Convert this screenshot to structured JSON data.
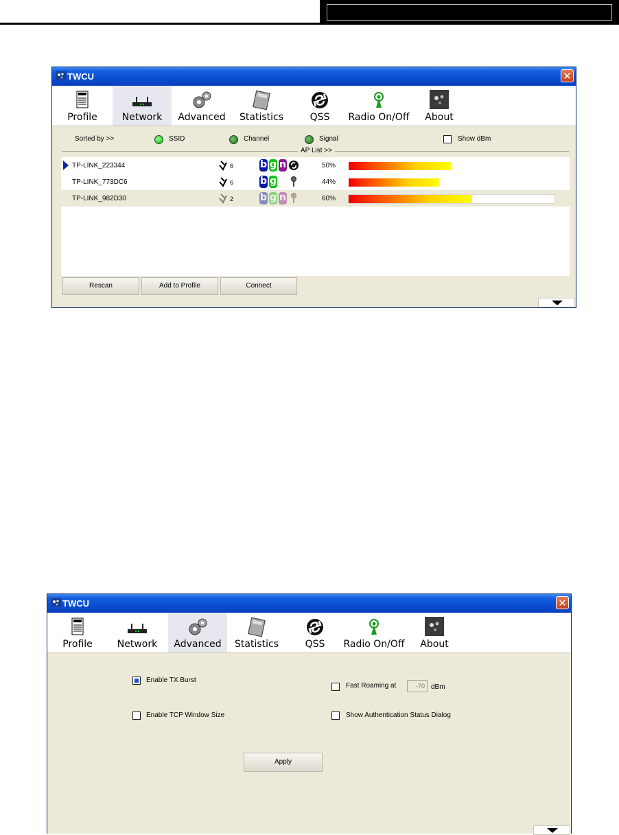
{
  "window1": {
    "title": "TWCU",
    "close_glyph": "✕",
    "toolbar": [
      {
        "label": "Profile",
        "icon": "profile-icon"
      },
      {
        "label": "Network",
        "icon": "network-icon",
        "active": true
      },
      {
        "label": "Advanced",
        "icon": "gears-icon"
      },
      {
        "label": "Statistics",
        "icon": "calculator-icon"
      },
      {
        "label": "QSS",
        "icon": "qss-icon"
      },
      {
        "label": "Radio On/Off",
        "icon": "radio-antenna-icon"
      },
      {
        "label": "About",
        "icon": "about-icon"
      }
    ],
    "sort": {
      "label": "Sorted by >>",
      "options": [
        "SSID",
        "Channel",
        "Signal"
      ],
      "show_dbm": "Show dBm"
    },
    "ap_list_label": "AP List >>",
    "aps": [
      {
        "ssid": "TP-LINK_223344",
        "channel": "6",
        "modes": [
          "b",
          "g",
          "n"
        ],
        "qss": true,
        "secured": false,
        "signal": "50%",
        "signal_level": 0.5
      },
      {
        "ssid": "TP-LINK_773DC6",
        "channel": "6",
        "modes": [
          "b",
          "g"
        ],
        "qss": false,
        "secured": true,
        "signal": "44%",
        "signal_level": 0.44
      },
      {
        "ssid": "TP-LINK_982D30",
        "channel": "2",
        "modes": [
          "b",
          "g",
          "n"
        ],
        "qss": false,
        "secured": true,
        "signal": "60%",
        "signal_level": 0.6
      }
    ],
    "buttons": {
      "rescan": "Rescan",
      "add_to_profile": "Add to Profile",
      "connect": "Connect"
    }
  },
  "window2": {
    "title": "TWCU",
    "close_glyph": "✕",
    "toolbar": [
      {
        "label": "Profile",
        "icon": "profile-icon"
      },
      {
        "label": "Network",
        "icon": "network-icon"
      },
      {
        "label": "Advanced",
        "icon": "gears-icon",
        "active": true
      },
      {
        "label": "Statistics",
        "icon": "calculator-icon"
      },
      {
        "label": "QSS",
        "icon": "qss-icon"
      },
      {
        "label": "Radio On/Off",
        "icon": "radio-antenna-icon"
      },
      {
        "label": "About",
        "icon": "about-icon"
      }
    ],
    "options": {
      "tx_burst": {
        "label": "Enable TX Burst",
        "checked": true
      },
      "tcp_window": {
        "label": "Enable TCP Window Size",
        "checked": false
      },
      "fast_roaming": {
        "label": "Fast Roaming at",
        "checked": false,
        "value": "-70",
        "unit": "dBm"
      },
      "auth_dialog": {
        "label": "Show Authentication Status Dialog",
        "checked": false
      }
    },
    "apply": "Apply"
  }
}
